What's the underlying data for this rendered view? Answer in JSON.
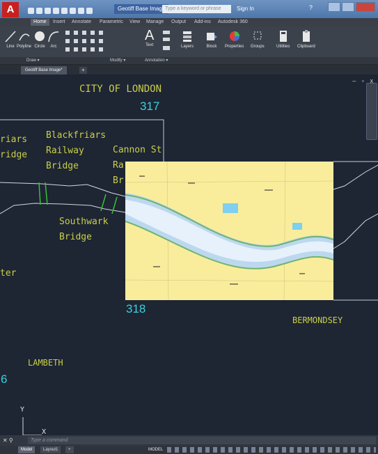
{
  "titlebar": {
    "app_logo": "A",
    "doc_title": "Geotiff Base Image",
    "search_placeholder": "Type a keyword or phrase",
    "signin": "Sign In",
    "help": "?"
  },
  "ribbon_tabs": [
    "Home",
    "Insert",
    "Annotate",
    "Parametric",
    "View",
    "Manage",
    "Output",
    "Add-ins",
    "Autodesk 360"
  ],
  "tools": {
    "line": "Line",
    "polyline": "Polyline",
    "circle": "Circle",
    "arc": "Arc",
    "text": "Text",
    "layers": "Layers",
    "block": "Block",
    "properties": "Properties",
    "groups": "Groups",
    "utilities": "Utilities",
    "clipboard": "Clipboard"
  },
  "panels": {
    "draw": "Draw ▾",
    "modify": "Modify ▾",
    "annotation": "Annotation ▾"
  },
  "doc_tab": {
    "label": "Geotiff Base Image*",
    "add": "+"
  },
  "canvas": {
    "viewport_controls": "– ▫ x",
    "labels": {
      "city": "CITY OF LONDON",
      "friars": "riars",
      "ridge": "ridge",
      "blackfriars1": "Blackfriars",
      "blackfriars2": "Railway",
      "blackfriars3": "Bridge",
      "cannon1": "Cannon St",
      "cannon2": "Ra",
      "cannon3": "Br",
      "southwark1": "Southwark",
      "southwark2": "Bridge",
      "ter": "ter",
      "bermondsey": "BERMONDSEY",
      "lambeth": "LAMBETH",
      "ucs_y": "Y",
      "ucs_x": "X"
    },
    "numbers": {
      "n317": "317",
      "n318": "318",
      "n6": "6"
    }
  },
  "command": {
    "close": "✕ ⚲",
    "placeholder": "Type a command"
  },
  "status": {
    "model_tab": "Model",
    "layout_tab": "Layout1",
    "add": "+",
    "model_label": "MODEL"
  },
  "colors": {
    "cad_yellow": "#c8d04a",
    "cad_cyan": "#38d2dc",
    "canvas_bg": "#1e2533",
    "chart_bg": "#f9ed9c"
  }
}
